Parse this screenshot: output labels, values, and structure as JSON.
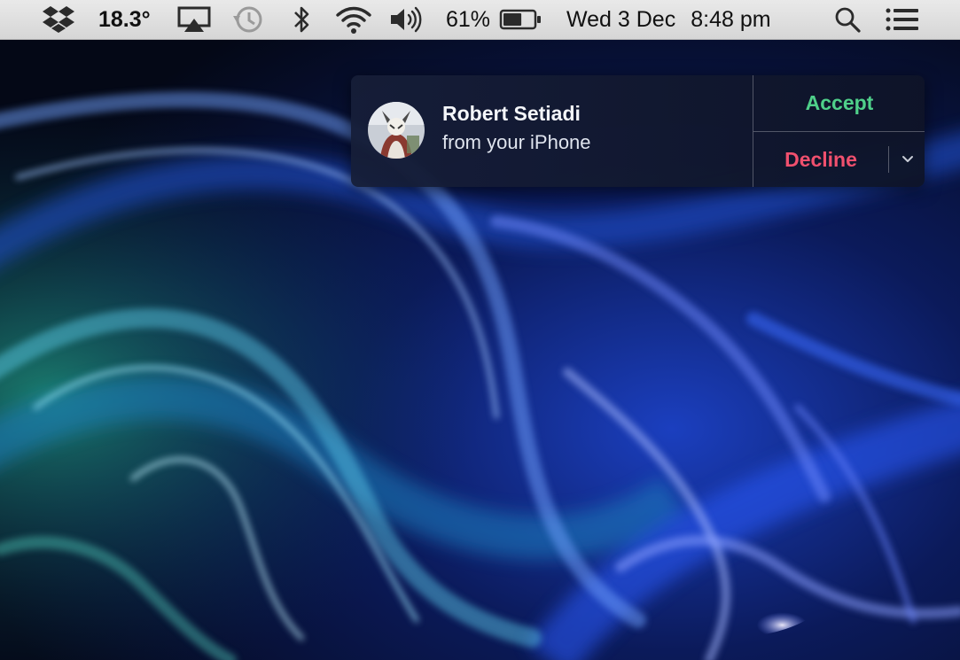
{
  "menubar": {
    "icons": [
      "dropbox-icon",
      "airplay-icon",
      "time-machine-icon",
      "bluetooth-icon",
      "wifi-icon",
      "volume-icon",
      "battery-icon",
      "spotlight-icon",
      "notification-center-icon"
    ],
    "temperature": "18.3°",
    "battery_percent": "61%",
    "battery_level": 0.61,
    "date": "Wed 3 Dec",
    "time": "8:48 pm"
  },
  "notification": {
    "caller_name": "Robert Setiadi",
    "subtitle": "from your iPhone",
    "accept_label": "Accept",
    "decline_label": "Decline",
    "options_icon": "chevron-down-icon",
    "accept_color": "#4fd08a",
    "decline_color": "#f0506e"
  },
  "wallpaper": {
    "description_colors": [
      "#050a1c",
      "#1a4bd6",
      "#36b6e6",
      "#1f9a8a"
    ]
  }
}
